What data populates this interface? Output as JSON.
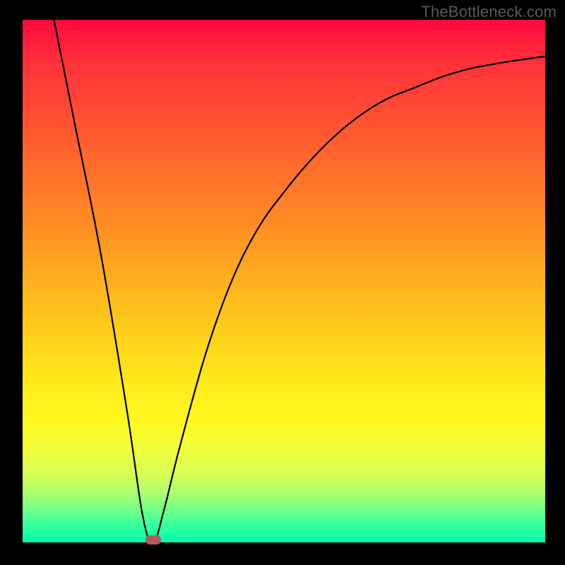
{
  "watermark": "TheBottleneck.com",
  "chart_data": {
    "type": "line",
    "title": "",
    "xlabel": "",
    "ylabel": "",
    "xlim": [
      0,
      100
    ],
    "ylim": [
      0,
      100
    ],
    "series": [
      {
        "name": "curve",
        "x": [
          6,
          10,
          15,
          20,
          23,
          25,
          27,
          30,
          35,
          40,
          45,
          50,
          55,
          60,
          65,
          70,
          75,
          80,
          85,
          90,
          95,
          100
        ],
        "y": [
          100,
          80,
          55,
          25,
          5,
          0,
          6,
          18,
          36,
          50,
          60,
          67,
          73,
          78,
          82,
          85,
          87,
          89,
          90.5,
          91.5,
          92.3,
          93
        ]
      }
    ],
    "marker": {
      "x": 25,
      "y": 0
    },
    "gradient_stops": [
      {
        "pos": 0,
        "color": "#ff0a3c"
      },
      {
        "pos": 100,
        "color": "#00ffae"
      }
    ]
  }
}
